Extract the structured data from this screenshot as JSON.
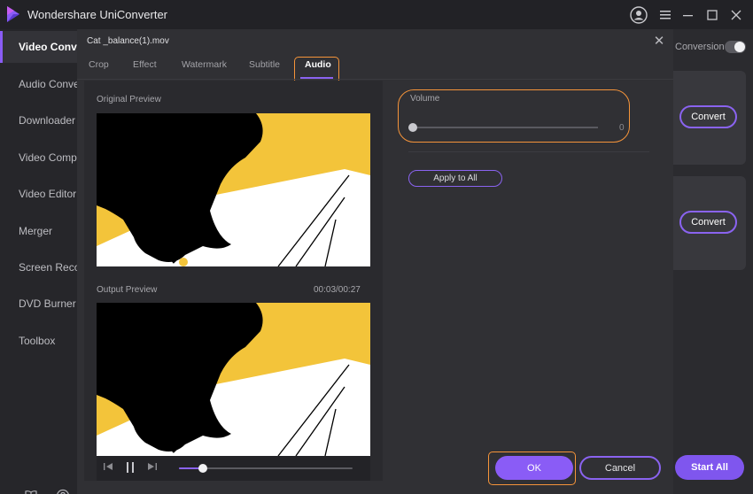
{
  "app": {
    "title": "Wondershare UniConverter",
    "accent": "#8a5cf6",
    "highlight": "#f5943a"
  },
  "window_controls": [
    {
      "icon": "account-icon"
    },
    {
      "icon": "menu-icon"
    },
    {
      "icon": "minimize-icon"
    },
    {
      "icon": "maximize-icon"
    },
    {
      "icon": "close-icon"
    }
  ],
  "sidebar": {
    "items": [
      {
        "label": "Video Conv",
        "active": true
      },
      {
        "label": "Audio Conve"
      },
      {
        "label": "Downloader"
      },
      {
        "label": "Video Comp"
      },
      {
        "label": "Video Editor"
      },
      {
        "label": "Merger"
      },
      {
        "label": "Screen Reco"
      },
      {
        "label": "DVD Burner"
      },
      {
        "label": "Toolbox"
      }
    ],
    "bottom_icons": [
      "book-icon",
      "help-icon",
      "user-icon"
    ]
  },
  "main": {
    "conversion_label": "Conversion",
    "convert_buttons": [
      "Convert",
      "Convert"
    ],
    "start_all": "Start All"
  },
  "dialog": {
    "title": "Cat _balance(1).mov",
    "tabs": [
      "Crop",
      "Effect",
      "Watermark",
      "Subtitle",
      "Audio"
    ],
    "active_tab": "Audio",
    "original_preview_label": "Original Preview",
    "output_preview_label": "Output Preview",
    "time": "00:03/00:27",
    "playback_progress": 0.14,
    "volume": {
      "label": "Volume",
      "value": "0",
      "level": 0
    },
    "apply_all": "Apply to All",
    "ok": "OK",
    "cancel": "Cancel"
  }
}
